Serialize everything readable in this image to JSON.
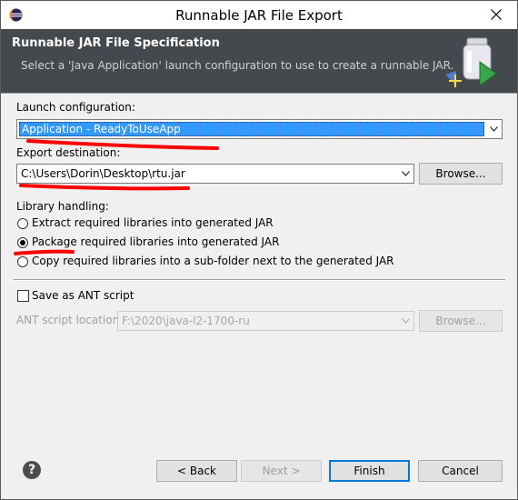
{
  "window": {
    "title": "Runnable JAR File Export",
    "close_icon": "close-icon"
  },
  "banner": {
    "title": "Runnable JAR File Specification",
    "description": "Select a 'Java Application' launch configuration to use to create a runnable JAR.",
    "icon": "jar-export-icon"
  },
  "launch": {
    "label": "Launch configuration:",
    "value": "Application - ReadyToUseApp"
  },
  "export": {
    "label": "Export destination:",
    "value": "C:\\Users\\Dorin\\Desktop\\rtu.jar",
    "browse_label": "Browse..."
  },
  "library": {
    "label": "Library handling:",
    "options": [
      {
        "label": "Extract required libraries into generated JAR",
        "selected": false
      },
      {
        "label": "Package required libraries into generated JAR",
        "selected": true
      },
      {
        "label": "Copy required libraries into a sub-folder next to the generated JAR",
        "selected": false
      }
    ]
  },
  "ant": {
    "checkbox_label": "Save as ANT script",
    "checked": false,
    "location_label": "ANT script location:",
    "location_value": "F:\\2020\\java-l2-1700-ru",
    "browse_label": "Browse..."
  },
  "footer": {
    "help_symbol": "?",
    "back_label": "< Back",
    "next_label": "Next >",
    "finish_label": "Finish",
    "cancel_label": "Cancel"
  },
  "colors": {
    "banner_bg": "#44494d",
    "selection": "#3399ff",
    "annotation_red": "#ff0000",
    "default_button_border": "#0078d7"
  }
}
